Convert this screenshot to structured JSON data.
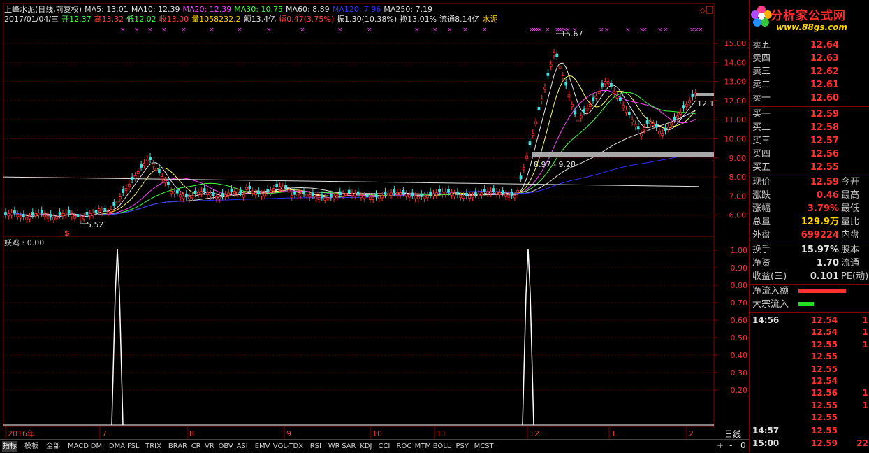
{
  "header": {
    "title": "上峰水泥(日线,前复权)",
    "ma": [
      {
        "label": "MA5: 13.01",
        "color": "#e0e0e0"
      },
      {
        "label": "MA10: 12.39",
        "color": "#e0e0e0"
      },
      {
        "label": "MA20: 12.39",
        "color": "#ff40ff"
      },
      {
        "label": "MA30: 10.75",
        "color": "#40ff40"
      },
      {
        "label": "MA60: 8.89",
        "color": "#e0e0e0"
      },
      {
        "label": "MA120: 7.96",
        "color": "#3030ff"
      },
      {
        "label": "MA250: 7.19",
        "color": "#e0e0e0"
      }
    ],
    "info": [
      {
        "label": "2017/01/04/三",
        "color": "#e0e0e0"
      },
      {
        "label": "开12.37",
        "color": "#40ff40"
      },
      {
        "label": "高13.32",
        "color": "#ff4040"
      },
      {
        "label": "低12.02",
        "color": "#40ff40"
      },
      {
        "label": "收13.00",
        "color": "#ff4040"
      },
      {
        "label": "量1058232.2",
        "color": "#ffd400"
      },
      {
        "label": "额13.4亿",
        "color": "#e0e0e0"
      },
      {
        "label": "幅0.47(3.75%)",
        "color": "#ff4040"
      },
      {
        "label": "振1.30(10.38%)",
        "color": "#e0e0e0"
      },
      {
        "label": "换13.01%",
        "color": "#e0e0e0"
      },
      {
        "label": "流通8.14亿",
        "color": "#e0e0e0"
      },
      {
        "label": "水泥",
        "color": "#ffd400"
      }
    ]
  },
  "indicator": {
    "label": "妖鸡 : 0.00"
  },
  "annotations": {
    "high": "15.67",
    "low": "5.52",
    "range": "8.97 - 9.28",
    "current": "12.1",
    "signal": "$"
  },
  "price_axis": [
    "15.00",
    "14.00",
    "13.00",
    "12.00",
    "11.00",
    "10.00",
    "9.00",
    "8.00",
    "7.00",
    "6.00"
  ],
  "ind_axis": [
    "1.00",
    "0.90",
    "0.80",
    "0.70",
    "0.60",
    "0.50",
    "0.40",
    "0.30",
    "0.20"
  ],
  "time_axis": [
    "2016年",
    "7",
    "8",
    "9",
    "10",
    "11",
    "12",
    "1",
    "2"
  ],
  "period": "日线",
  "tabs": [
    "指标",
    "模板",
    "全部",
    "MACD",
    "DMI",
    "DMA",
    "FSL",
    "TRIX",
    "BRAR",
    "CR",
    "VR",
    "OBV",
    "ASI",
    "EMV",
    "VOL-TDX",
    "RSI",
    "WR",
    "SAR",
    "KDJ",
    "CCI",
    "ROC",
    "MTM",
    "BOLL",
    "PSY",
    "MCST"
  ],
  "controls": [
    "+",
    "-",
    "0"
  ],
  "logo": {
    "name": "分析家公式网",
    "url": "www.88gs.com"
  },
  "quote": {
    "sell": [
      {
        "label": "卖五",
        "price": "12.64"
      },
      {
        "label": "卖四",
        "price": "12.63"
      },
      {
        "label": "卖三",
        "price": "12.62"
      },
      {
        "label": "卖二",
        "price": "12.61"
      },
      {
        "label": "卖一",
        "price": "12.60"
      }
    ],
    "buy": [
      {
        "label": "买一",
        "price": "12.59"
      },
      {
        "label": "买二",
        "price": "12.58"
      },
      {
        "label": "买三",
        "price": "12.57"
      },
      {
        "label": "买四",
        "price": "12.56"
      },
      {
        "label": "买五",
        "price": "12.55"
      }
    ],
    "stats": [
      {
        "label": "现价",
        "value": "12.59",
        "color": "#ff3030",
        "label2": "今开"
      },
      {
        "label": "涨跌",
        "value": "0.46",
        "color": "#ff3030",
        "label2": "最高"
      },
      {
        "label": "涨幅",
        "value": "3.79%",
        "color": "#ff3030",
        "label2": "最低"
      },
      {
        "label": "总量",
        "value": "129.9万",
        "color": "#ffd400",
        "label2": "量比"
      },
      {
        "label": "外盘",
        "value": "699224",
        "color": "#ff3030",
        "label2": "内盘"
      }
    ],
    "stats2": [
      {
        "label": "换手",
        "value": "15.97%",
        "color": "#e0e0e0",
        "label2": "股本"
      },
      {
        "label": "净资",
        "value": "1.70",
        "color": "#e0e0e0",
        "label2": "流通"
      },
      {
        "label": "收益(三)",
        "value": "0.101",
        "color": "#e0e0e0",
        "label2": "PE(动)"
      }
    ],
    "flow": [
      {
        "label": "净流入额",
        "color": "#ff3030",
        "level": 0.62
      },
      {
        "label": "大宗流入",
        "color": "#20e020",
        "level": 0.2
      }
    ],
    "ticks": [
      {
        "time": "14:56",
        "price": "12.54",
        "extra": "1"
      },
      {
        "time": "",
        "price": "12.54",
        "extra": "1"
      },
      {
        "time": "",
        "price": "12.55",
        "extra": "1"
      },
      {
        "time": "",
        "price": "12.55",
        "extra": ""
      },
      {
        "time": "",
        "price": "12.55",
        "extra": ""
      },
      {
        "time": "",
        "price": "12.54",
        "extra": ""
      },
      {
        "time": "",
        "price": "12.56",
        "extra": "1"
      },
      {
        "time": "",
        "price": "12.55",
        "extra": "1"
      },
      {
        "time": "",
        "price": "12.55",
        "extra": ""
      },
      {
        "time": "14:57",
        "price": "12.55",
        "extra": ""
      },
      {
        "time": "15:00",
        "price": "12.59",
        "extra": "22"
      }
    ]
  }
}
